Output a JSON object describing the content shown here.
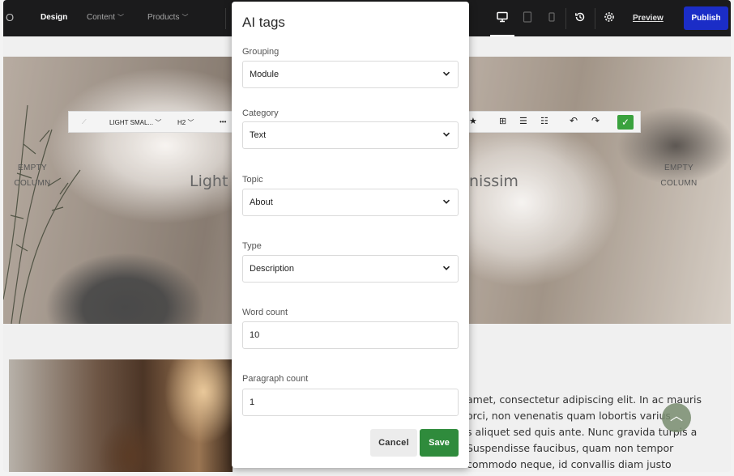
{
  "topbar": {
    "logo": "O",
    "nav": [
      {
        "label": "Design",
        "active": true
      },
      {
        "label": "Content",
        "active": false
      },
      {
        "label": "Products",
        "active": false
      }
    ],
    "preview_label": "Preview",
    "publish_label": "Publish",
    "device_icons": [
      "desktop-icon",
      "tablet-icon",
      "mobile-icon"
    ],
    "accent": "#1b2dc7"
  },
  "editor_toolbar": {
    "style_label": "LIGHT SMAL...",
    "heading_label": "H2",
    "more_label": "•••"
  },
  "hero": {
    "empty_left": [
      "EMPTY",
      "COLUMN"
    ],
    "empty_right": [
      "EMPTY",
      "COLUMN"
    ],
    "heading_left": "Light S",
    "heading_right": "nissim"
  },
  "body_text": [
    "amet, consectetur adipiscing elit. In ac mauris",
    "orci, non venenatis quam lobortis varius",
    "s aliquet sed quis ante. Nunc gravida turpis a",
    "Suspendisse faucibus, quam non tempor",
    "commodo neque, id convallis diam justo"
  ],
  "modal": {
    "title": "AI tags",
    "fields": {
      "grouping": {
        "label": "Grouping",
        "value": "Module"
      },
      "category": {
        "label": "Category",
        "value": "Text"
      },
      "topic": {
        "label": "Topic",
        "value": "About"
      },
      "type": {
        "label": "Type",
        "value": "Description"
      },
      "word_count": {
        "label": "Word count",
        "value": "10"
      },
      "paragraph_count": {
        "label": "Paragraph count",
        "value": "1"
      }
    },
    "cancel_label": "Cancel",
    "save_label": "Save",
    "save_color": "#2f8b3c"
  }
}
